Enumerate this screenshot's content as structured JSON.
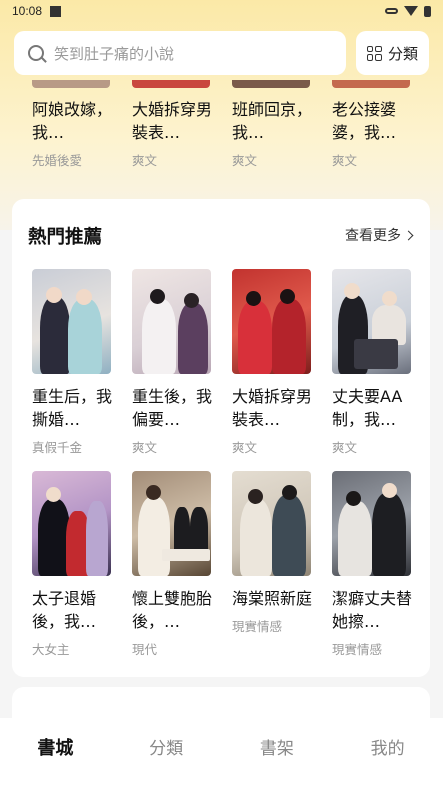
{
  "status_bar": {
    "time": "10:08"
  },
  "search": {
    "placeholder": "笑到肚子痛的小說"
  },
  "category_button": {
    "label": "分類"
  },
  "top_books": [
    {
      "title": "阿娘改嫁，我…",
      "tag": "先婚後愛"
    },
    {
      "title": "大婚拆穿男裝表…",
      "tag": "爽文"
    },
    {
      "title": "班師回京，我…",
      "tag": "爽文"
    },
    {
      "title": "老公接婆婆，我…",
      "tag": "爽文"
    }
  ],
  "hot_section": {
    "title": "熱門推薦",
    "more_label": "查看更多",
    "books": [
      {
        "title": "重生后，我撕婚…",
        "tag": "真假千金"
      },
      {
        "title": "重生後，我偏要…",
        "tag": "爽文"
      },
      {
        "title": "大婚拆穿男裝表…",
        "tag": "爽文"
      },
      {
        "title": "丈夫要AA制，我…",
        "tag": "爽文"
      },
      {
        "title": "太子退婚後，我…",
        "tag": "大女主"
      },
      {
        "title": "懷上雙胞胎後，…",
        "tag": "現代"
      },
      {
        "title": "海棠照新庭",
        "tag": "現實情感"
      },
      {
        "title": "潔癖丈夫替她擦…",
        "tag": "現實情感"
      }
    ]
  },
  "bottom_nav": {
    "items": [
      {
        "label": "書城",
        "active": true
      },
      {
        "label": "分類",
        "active": false
      },
      {
        "label": "書架",
        "active": false
      },
      {
        "label": "我的",
        "active": false
      }
    ]
  },
  "colors": {
    "header_gradient_top": "#fbe9a7",
    "background": "#f5f5f5",
    "tag_gray": "#999999"
  }
}
